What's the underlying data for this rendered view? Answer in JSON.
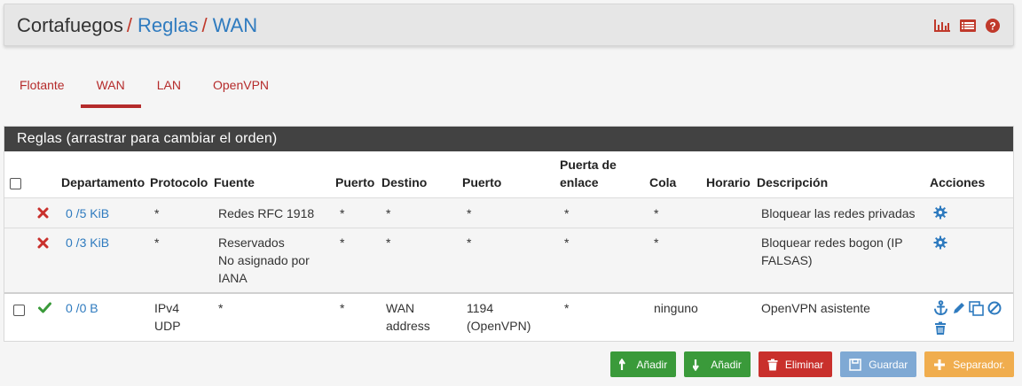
{
  "breadcrumb": {
    "root": "Cortafuegos",
    "items": [
      "Reglas",
      "WAN"
    ],
    "separator": "/"
  },
  "header_icons": [
    "chart-icon",
    "list-icon",
    "help-icon"
  ],
  "tabs": [
    {
      "label": "Flotante",
      "active": false
    },
    {
      "label": "WAN",
      "active": true
    },
    {
      "label": "LAN",
      "active": false
    },
    {
      "label": "OpenVPN",
      "active": false
    }
  ],
  "panel": {
    "title": "Reglas (arrastrar para cambiar el orden)"
  },
  "table": {
    "headers": {
      "departamento": "Departamento",
      "protocolo": "Protocolo",
      "fuente": "Fuente",
      "puerto": "Puerto",
      "destino": "Destino",
      "puerto2": "Puerto",
      "gateway_line1": "Puerta de",
      "gateway_line2": "enlace",
      "cola": "Cola",
      "horario": "Horario",
      "descripcion": "Descripción",
      "acciones": "Acciones"
    },
    "rows": [
      {
        "status": "blocked",
        "states": "0 /5 KiB",
        "protocol": "*",
        "source": "Redes RFC 1918",
        "source_port": "*",
        "destination": "*",
        "destination_port": "*",
        "gateway": "*",
        "queue": "*",
        "schedule": "",
        "description": "Bloquear las redes privadas"
      },
      {
        "status": "blocked",
        "states": "0 /3 KiB",
        "protocol": "*",
        "source_lines": [
          "Reservados",
          "No asignado por",
          "IANA"
        ],
        "source_port": "*",
        "destination": "*",
        "destination_port": "*",
        "gateway": "*",
        "queue": "*",
        "schedule": "",
        "description_lines": [
          "Bloquear redes bogon (IP",
          "FALSAS)"
        ]
      },
      {
        "status": "pass",
        "states": "0 /0 B",
        "protocol_lines": [
          "IPv4",
          "UDP"
        ],
        "source": "*",
        "source_port": "*",
        "destination_lines": [
          "WAN",
          "address"
        ],
        "destination_port_lines": [
          "1194",
          "(OpenVPN)"
        ],
        "gateway": "*",
        "queue": "ninguno",
        "schedule": "",
        "description": "OpenVPN asistente"
      }
    ]
  },
  "footer_buttons": [
    {
      "label": "Añadir",
      "icon": "arrow-up-icon",
      "color": "#3a9a3a"
    },
    {
      "label": "Añadir",
      "icon": "arrow-down-icon",
      "color": "#3a9a3a"
    },
    {
      "label": "Eliminar",
      "icon": "trash-icon",
      "color": "#c9302c"
    },
    {
      "label": "Guardar",
      "icon": "save-icon",
      "color": "#7fa9d4"
    },
    {
      "label": "Separador.",
      "icon": "plus-icon",
      "color": "#f0ad4e"
    }
  ],
  "colors": {
    "accent_red": "#b52b2b",
    "link_blue": "#2f7bbf",
    "panel_header": "#424242",
    "pass_green": "#3a9a3a"
  }
}
